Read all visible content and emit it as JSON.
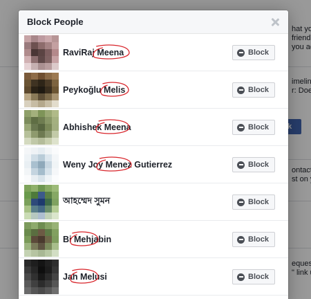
{
  "dialog": {
    "title": "Block People",
    "close_icon": "close-icon"
  },
  "background": {
    "snippets": [
      "hat you",
      "friend\"",
      "you add",
      "imeline",
      "r: Does",
      "ck",
      "ontact",
      "st on y",
      "equests",
      "\" link u"
    ]
  },
  "people": [
    {
      "name": "RaviRaj Meena",
      "button_label": "Block",
      "avatar_colors": [
        "#c7a4a6",
        "#a8878a",
        "#bd9aa0",
        "#caa8ab",
        "#b79596",
        "#9a7b7d",
        "#6d5150",
        "#8d6c6c",
        "#a58384",
        "#c4a0a1",
        "#b08b8c",
        "#4a3635",
        "#5b4443",
        "#7d5e5f",
        "#b4898b",
        "#d1b1b3",
        "#8e6f70",
        "#5f4848",
        "#7f6262",
        "#c7a2a4",
        "#e6d2d4",
        "#c6b0b1",
        "#aa9091",
        "#b89d9e",
        "#dccaca"
      ]
    },
    {
      "name": "Peykoğlu Melis",
      "button_label": "Block",
      "avatar_colors": [
        "#7a5a3a",
        "#8e6c48",
        "#6f4f30",
        "#8a6a46",
        "#9c7a52",
        "#6a5434",
        "#3f3322",
        "#2e2518",
        "#4a3a26",
        "#7d6440",
        "#5e4a2e",
        "#2a2216",
        "#1f1a12",
        "#3a2e1e",
        "#6c5634",
        "#b9a684",
        "#8a7a58",
        "#5d4e36",
        "#7c6a4a",
        "#a89472",
        "#d8d0be",
        "#c6bca4",
        "#b4a88c",
        "#c8bea6",
        "#e2dccc"
      ]
    },
    {
      "name": "Abhishek Meena",
      "button_label": "Block",
      "avatar_colors": [
        "#8fa06a",
        "#a3b07c",
        "#7e9458",
        "#9aa874",
        "#b0ba88",
        "#7c8c5c",
        "#5f6e44",
        "#6e7c50",
        "#889666",
        "#a4b080",
        "#9aa878",
        "#6a7850",
        "#586640",
        "#7a8858",
        "#a2ae80",
        "#b6c09a",
        "#8e9a6e",
        "#6e7a52",
        "#8c9870",
        "#c2caa8",
        "#d4dac0",
        "#c0c8a8",
        "#b4bc9a",
        "#c8cfae",
        "#dde2cc"
      ]
    },
    {
      "name": "Weny Joy Menez Gutierrez",
      "button_label": "Block",
      "avatar_colors": [
        "#f4f6f8",
        "#eef2f5",
        "#e6edf2",
        "#f2f5f7",
        "#fafbfc",
        "#eef3f6",
        "#cfdde6",
        "#b9ccd8",
        "#dde7ee",
        "#f3f6f8",
        "#e9eff3",
        "#a9c0cf",
        "#8fa9ba",
        "#c8d7e1",
        "#f0f4f6",
        "#f2f5f7",
        "#c4d4df",
        "#a4bccb",
        "#d6e2ea",
        "#f5f7f9",
        "#fafbfc",
        "#e8eef2",
        "#d8e3ea",
        "#eef3f6",
        "#fbfcfd"
      ]
    },
    {
      "name": "আহম্মেদ সুমন",
      "button_label": "Block",
      "avatar_colors": [
        "#7da35a",
        "#8fb06a",
        "#6e9650",
        "#88aa64",
        "#9cba78",
        "#6a9a4c",
        "#4e7a3a",
        "#3c5a8a",
        "#5a8044",
        "#86a864",
        "#7aa05a",
        "#2e4a7a",
        "#1e3a6e",
        "#3e6a48",
        "#7fa260",
        "#a8c286",
        "#5a7f8a",
        "#466a86",
        "#6a8e6a",
        "#b4cc94",
        "#cadcb4",
        "#b6c8c0",
        "#aebed0",
        "#c2d2b8",
        "#dae6cc"
      ]
    },
    {
      "name": "Bi Mehjabin",
      "button_label": "Block",
      "avatar_colors": [
        "#7c9a5c",
        "#8eaa6c",
        "#6e8c50",
        "#86a264",
        "#98b276",
        "#6a8a4c",
        "#5a6e40",
        "#6c5a44",
        "#5e7a46",
        "#82a060",
        "#7a9a58",
        "#5c4a3a",
        "#4a3a2e",
        "#6e6648",
        "#7e9c5e",
        "#9cb47e",
        "#7a7a5a",
        "#5e5442",
        "#7a8a5c",
        "#a8be8c",
        "#c4d2b2",
        "#b6c4a2",
        "#a8b894",
        "#b8c8a4",
        "#d2dec4"
      ]
    },
    {
      "name": "Jah Melusi",
      "button_label": "Block",
      "avatar_colors": [
        "#2a2a2a",
        "#1e1e1e",
        "#141414",
        "#202020",
        "#2e2e2e",
        "#3a3a3a",
        "#262626",
        "#0e0e0e",
        "#1c1c1c",
        "#363636",
        "#4a4a4a",
        "#303030",
        "#181818",
        "#2a2a2a",
        "#444444",
        "#5a5a5a",
        "#404040",
        "#2c2c2c",
        "#3c3c3c",
        "#565656",
        "#6a6a6a",
        "#555555",
        "#4a4a4a",
        "#585858",
        "#6e6e6e"
      ]
    }
  ],
  "annotation_color": "#d8242a"
}
